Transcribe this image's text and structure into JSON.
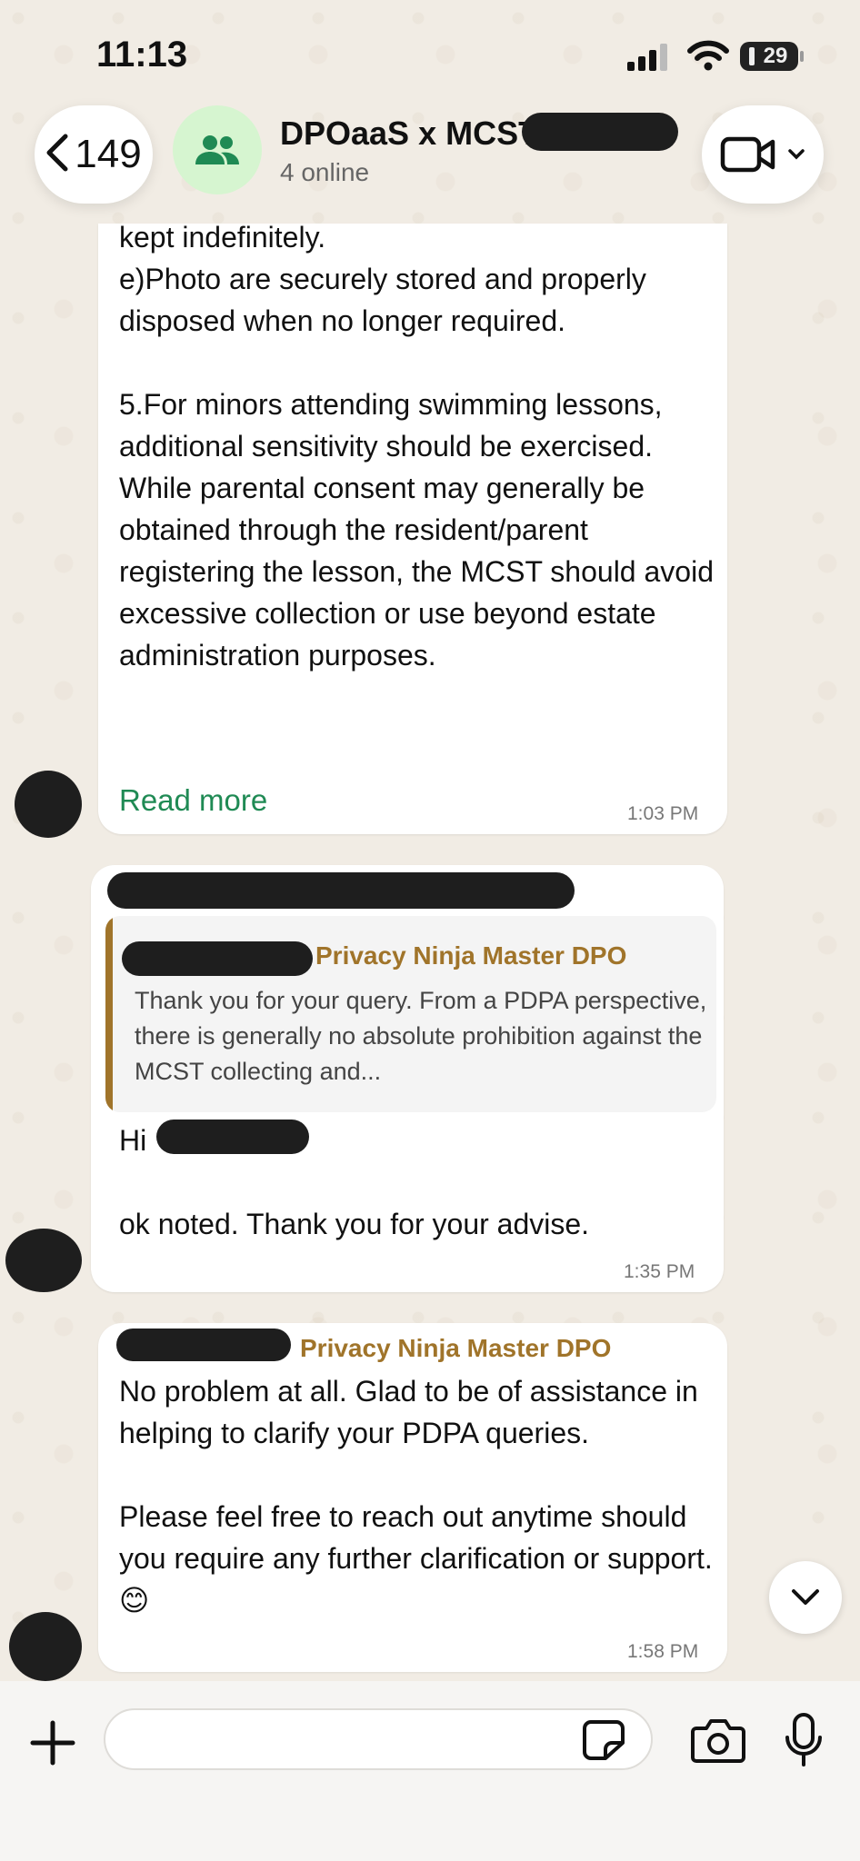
{
  "status_bar": {
    "time": "11:13",
    "battery": "29"
  },
  "header": {
    "back_count": "149",
    "title": "DPOaaS x MCST",
    "subtitle": "4 online"
  },
  "messages": [
    {
      "text": "kept indefinitely.\ne)Photo are securely stored and properly disposed when no longer required.\n\n5.For minors attending swimming lessons, additional sensitivity should be exercised. While parental consent may generally be obtained through the resident/parent registering the lesson, the MCST should avoid excessive collection or use beyond estate administration purposes.",
      "read_more": "Read more",
      "time": "1:03 PM"
    },
    {
      "quoted_sender": "Privacy Ninja Master DPO",
      "quoted_text": "Thank you for your query. From a PDPA perspective, there is generally no absolute prohibition against the MCST collecting and...",
      "greeting": "Hi",
      "text": "ok noted. Thank you for your advise.",
      "time": "1:35 PM"
    },
    {
      "sender": "Privacy Ninja Master DPO",
      "text": "No problem at all. Glad to be of assistance in helping to clarify your PDPA queries.\n\nPlease feel free to reach out anytime should you require any further clarification or support. 😊",
      "time": "1:58 PM"
    }
  ],
  "colors": {
    "sender_name": "#a0742a",
    "read_more": "#1f8a54",
    "group_avatar_bg": "#d6f5d0"
  },
  "icons": {
    "back": "chevron-left-icon",
    "group": "group-icon",
    "video": "video-camera-icon",
    "scroll": "chevron-down-icon",
    "plus": "plus-icon",
    "sticker": "sticker-icon",
    "camera": "camera-icon",
    "mic": "microphone-icon"
  }
}
